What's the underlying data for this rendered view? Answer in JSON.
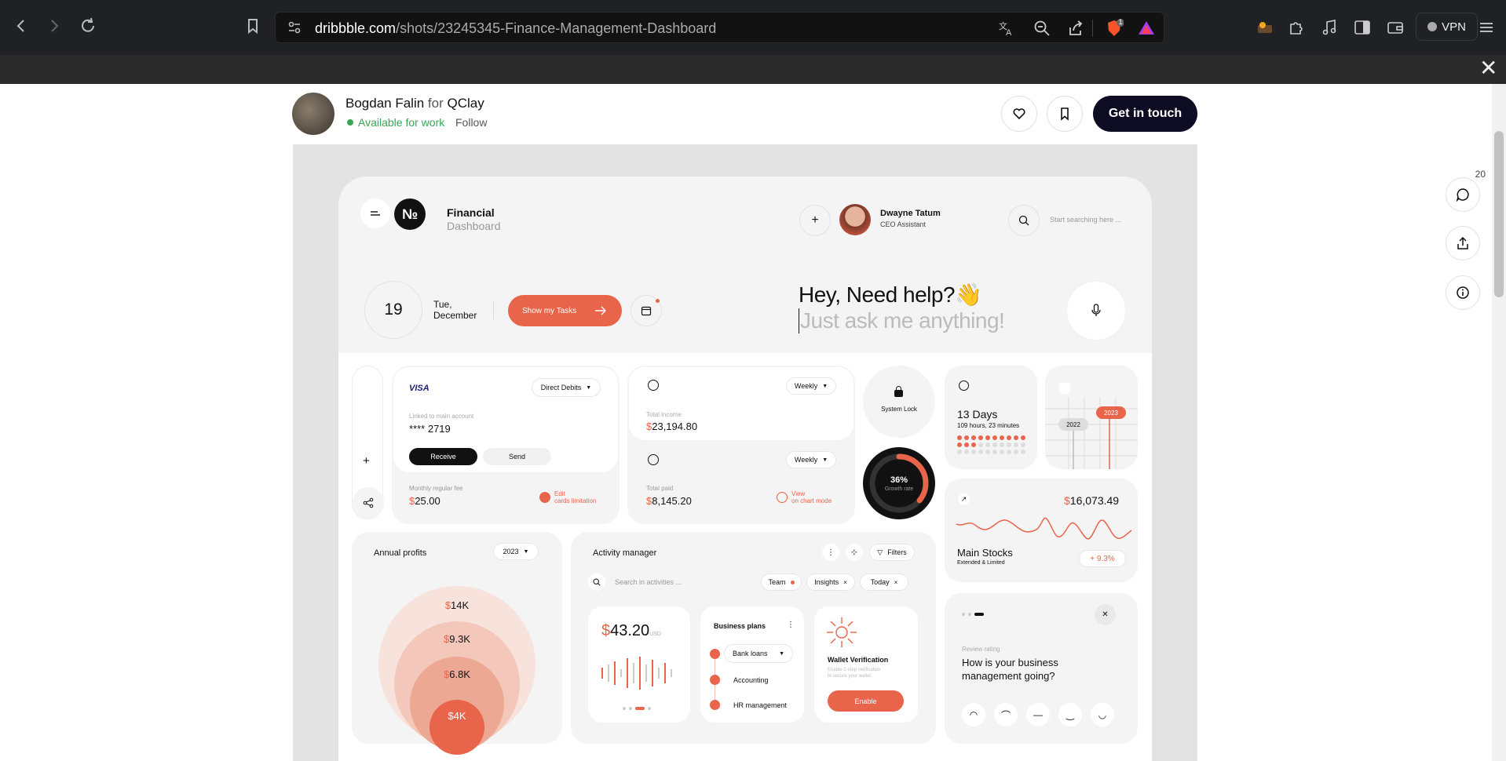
{
  "browser": {
    "url_domain": "dribbble.com",
    "url_path": "/shots/23245345-Finance-Management-Dashboard",
    "vpn_label": "VPN",
    "brave_badge": "1",
    "icons": [
      "back-icon",
      "forward-icon",
      "reload-icon",
      "bookmark-icon",
      "site-settings-icon",
      "translate-icon",
      "zoom-out-icon",
      "share-icon",
      "brave-shield-icon",
      "brave-rewards-icon",
      "extension-icon",
      "puzzle-icon",
      "music-icon",
      "sidebar-icon",
      "wallet-icon"
    ]
  },
  "shot_header": {
    "author": "Bogdan Falin",
    "for_word": "for",
    "team": "QClay",
    "availability": "Available for work",
    "follow": "Follow",
    "cta": "Get in touch",
    "comment_count": "20"
  },
  "dashboard": {
    "brand_title": "Financial",
    "brand_sub": "Dashboard",
    "brand_mark": "№",
    "user_name": "Dwayne Tatum",
    "user_role": "CEO Assistant",
    "search_placeholder": "Start searching here ...",
    "date_day": "19",
    "date_weekday": "Tue,",
    "date_month": "December",
    "tasks_button": "Show my Tasks",
    "help_title": "Hey, Need help?👋",
    "help_sub": "Just ask me anything!",
    "card": {
      "brand": "VISA",
      "debits": "Direct Debits",
      "linked": "Linked to main account",
      "number": "**** 2719",
      "receive": "Receive",
      "send": "Send",
      "fee_label": "Monthly regular fee",
      "fee_value": "25.00",
      "edit_line1": "Edit",
      "edit_line2": "cards limitation"
    },
    "income": {
      "period": "Weekly",
      "label": "Total income",
      "value": "23,194.80",
      "paid_period": "Weekly",
      "paid_label": "Total paid",
      "paid_value": "8,145.20",
      "view_line1": "View",
      "view_line2": "on chart mode"
    },
    "currency": "$",
    "system_lock": "System Lock",
    "growth_value": "36%",
    "growth_label": "Growth rate",
    "growth_fraction": 0.36,
    "days": {
      "title": "13 Days",
      "sub": "109 hours, 23 minutes"
    },
    "years": {
      "a": "2022",
      "b": "2023"
    },
    "stocks": {
      "value": "16,073.49",
      "title": "Main Stocks",
      "sub": "Extended & Limited",
      "change": "+ 9.3%"
    },
    "annual": {
      "title": "Annual profits",
      "year": "2023",
      "rings": [
        "14K",
        "9.3K",
        "6.8K",
        "4K"
      ]
    },
    "activity": {
      "title": "Activity manager",
      "filters": "Filters",
      "search": "Search in activities ...",
      "tags": [
        "Team",
        "Insights",
        "Today"
      ],
      "amount": "43.20",
      "amount_unit": "USD",
      "plans_title": "Business plans",
      "plans": [
        "Bank loans",
        "Accounting",
        "HR management"
      ],
      "wallet_title": "Wallet Verification",
      "wallet_desc1": "Enable 2-step verification",
      "wallet_desc2": "to secure your wallet.",
      "enable": "Enable"
    },
    "review": {
      "label": "Review rating",
      "q1": "How is your business",
      "q2": "management going?"
    }
  },
  "colors": {
    "accent": "#e8644a",
    "dark": "#0d0c22",
    "chrome": "#202124"
  }
}
